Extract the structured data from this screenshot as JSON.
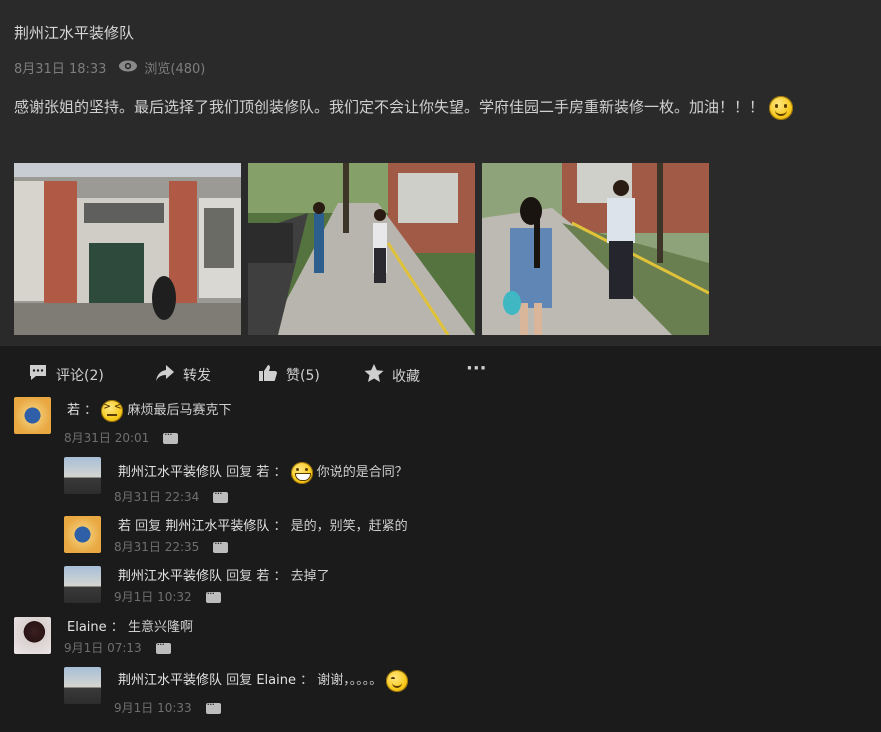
{
  "post": {
    "title": "荆州江水平装修队",
    "date": "8月31日 18:33",
    "views": "浏览(480)",
    "text": "感谢张姐的坚持。最后选择了我们顶创装修队。我们定不会让你失望。学府佳园二手房重新装修一枚。加油！！！"
  },
  "actions": {
    "comment": "评论(2)",
    "forward": "转发",
    "like": "赞(5)",
    "favorite": "收藏",
    "more": "···"
  },
  "comments": [
    {
      "name": "若",
      "sep": "：",
      "text": "麻烦最后马赛克下",
      "time": "8月31日 20:01"
    },
    {
      "name": "荆州江水平装修队",
      "reply": "回复",
      "target": "若",
      "sep": "：",
      "text": "你说的是合同？",
      "time": "8月31日 22:34"
    },
    {
      "name": "若",
      "reply": "回复",
      "target": "荆州江水平装修队",
      "sep": "：",
      "text": "是的，别笑，赶紧的",
      "time": "8月31日 22:35"
    },
    {
      "name": "荆州江水平装修队",
      "reply": "回复",
      "target": "若",
      "sep": "：",
      "text": "去掉了",
      "time": "9月1日 10:32"
    },
    {
      "name": "Elaine",
      "sep": "：",
      "text": "生意兴隆啊",
      "time": "9月1日 07:13"
    },
    {
      "name": "荆州江水平装修队",
      "reply": "回复",
      "target": "Elaine",
      "sep": "：",
      "text": "谢谢，。。。。",
      "time": "9月1日 10:33"
    }
  ]
}
